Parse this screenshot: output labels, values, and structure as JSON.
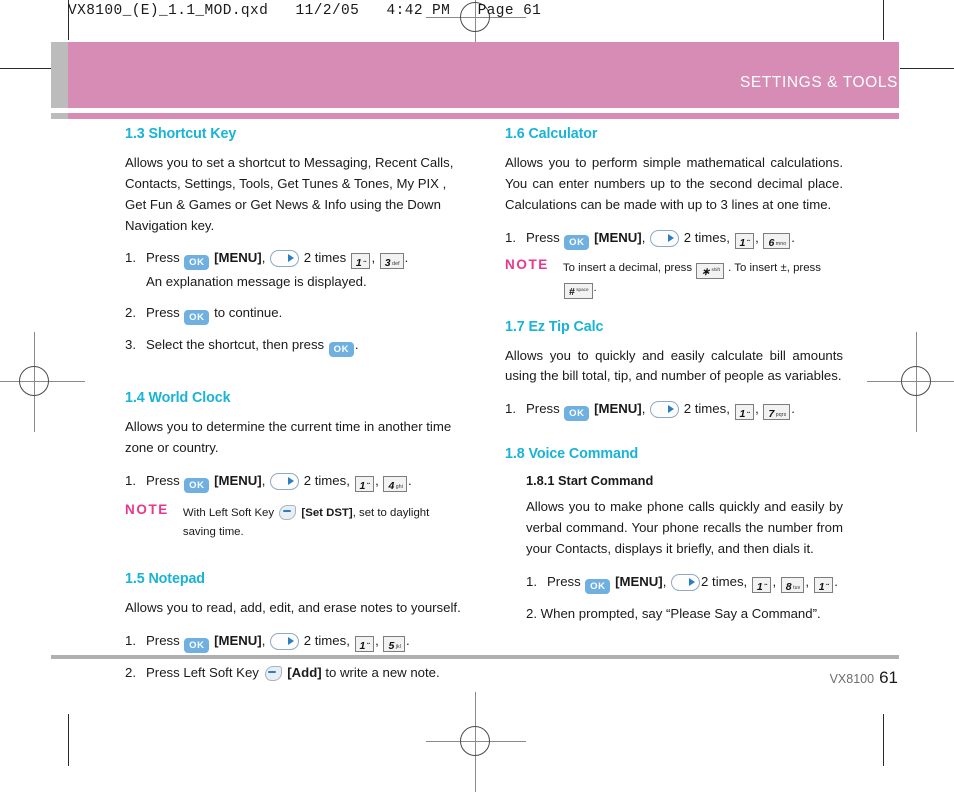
{
  "prepress": {
    "slug": "VX8100_(E)_1.1_MOD.qxd   11/2/05   4:42 PM   Page 61"
  },
  "banner": {
    "title": "SETTINGS & TOOLS",
    "color": "#d68cb4"
  },
  "colors": {
    "heading": "#19b3d6",
    "note": "#e8368f",
    "ok_key": "#6fb0e0",
    "banner": "#d68cb4"
  },
  "labels": {
    "note": "NOTE",
    "ok": "OK",
    "menu": "[MENU]",
    "two_times": "2 times",
    "two_times_comma": "2 times,",
    "press": "Press",
    "comma": ",",
    "period": ".",
    "set_dst": "[Set DST]",
    "add": "[Add]"
  },
  "keys": {
    "k1": {
      "digit": "1",
      "letters": "••"
    },
    "k3": {
      "digit": "3",
      "letters": "def"
    },
    "k4": {
      "digit": "4",
      "letters": "ghi"
    },
    "k5": {
      "digit": "5",
      "letters": "jkl"
    },
    "k6": {
      "digit": "6",
      "letters": "mno"
    },
    "k7": {
      "digit": "7",
      "letters": "pqrs"
    },
    "k8": {
      "digit": "8",
      "letters": "tuv"
    },
    "star": {
      "digit": "∗",
      "letters": "shift"
    },
    "hash": {
      "digit": "#",
      "letters": "space"
    }
  },
  "left_column": {
    "sections": [
      {
        "id": "1.3",
        "heading": "1.3 Shortcut Key",
        "intro": "Allows you to set a shortcut to Messaging, Recent Calls, Contacts, Settings, Tools, Get Tunes & Tones, My PIX , Get Fun & Games or Get News & Info using the Down Navigation key.",
        "steps": [
          {
            "num": "1.",
            "sub": "An explanation message is displayed."
          },
          {
            "num": "2.",
            "text_after": "to continue."
          },
          {
            "num": "3.",
            "text_before": "Select the shortcut, then press"
          }
        ]
      },
      {
        "id": "1.4",
        "heading": "1.4 World Clock",
        "intro": "Allows you to determine the current time in another time zone or country.",
        "note": {
          "before": "With Left Soft Key",
          "bold": "[Set DST]",
          "after": ", set to daylight saving time."
        }
      },
      {
        "id": "1.5",
        "heading": "1.5 Notepad",
        "intro": "Allows you to read, add, edit, and erase notes to yourself.",
        "step2": {
          "num": "2.",
          "before": "Press Left Soft Key",
          "bold": "[Add]",
          "after": "to write a new note."
        }
      }
    ]
  },
  "right_column": {
    "sections": [
      {
        "id": "1.6",
        "heading": "1.6 Calculator",
        "intro": "Allows you to perform simple mathematical calculations. You can enter numbers up to the second decimal place. Calculations can be made with up to 3 lines at one time.",
        "note": {
          "before": "To insert a decimal, press",
          "middle": ". To insert ±, press",
          "after": "."
        }
      },
      {
        "id": "1.7",
        "heading": "1.7 Ez Tip Calc",
        "intro": "Allows you to quickly and easily calculate bill amounts using the bill total, tip, and number of people as variables."
      },
      {
        "id": "1.8",
        "heading": "1.8 Voice Command",
        "subsection": {
          "heading": "1.8.1 Start Command",
          "intro": "Allows you to make phone calls quickly and easily by verbal command. Your phone recalls the number from your Contacts, displays it briefly, and then dials it.",
          "step2": "2.  When prompted, say “Please Say a Command”."
        }
      }
    ]
  },
  "footer": {
    "model": "VX8100",
    "page": "61"
  }
}
